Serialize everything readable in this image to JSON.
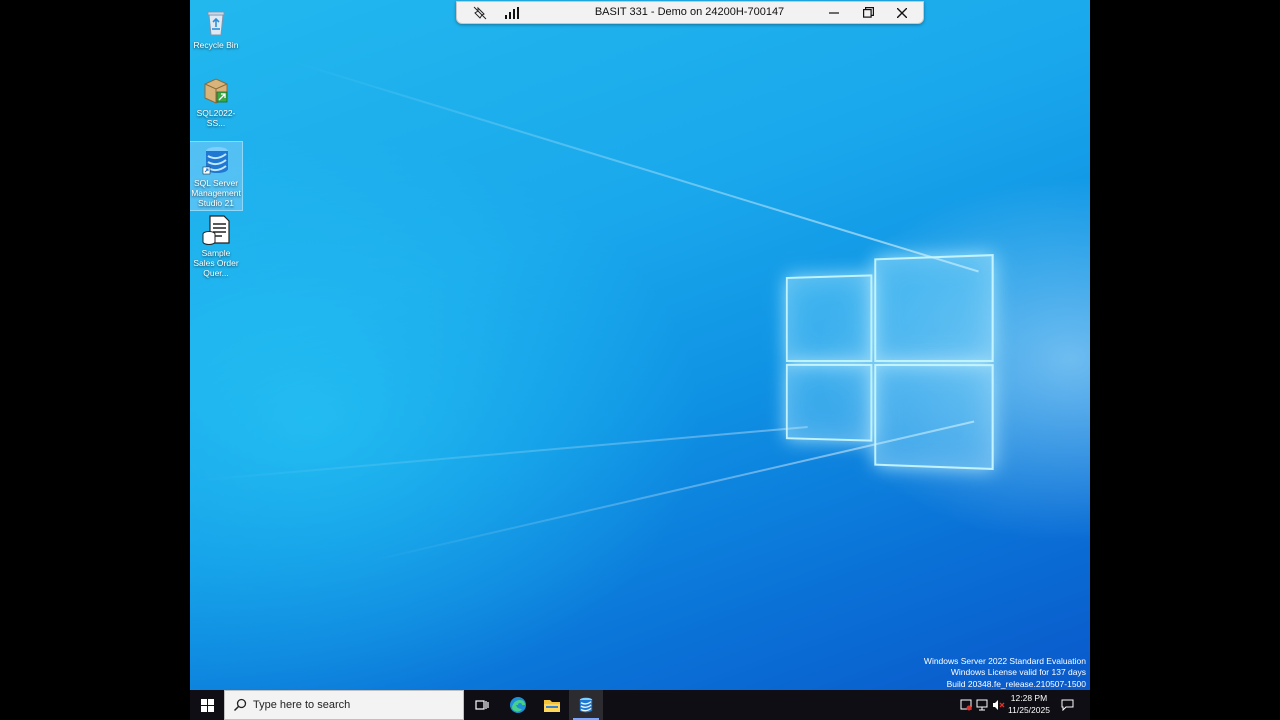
{
  "desktop": {
    "icons": [
      {
        "label": "Recycle Bin",
        "icon": "recycle-bin-icon"
      },
      {
        "label": "SQL2022-SS...",
        "icon": "installer-package-icon"
      },
      {
        "label": "SQL Server Management Studio 21",
        "icon": "ssms-icon"
      },
      {
        "label": "Sample Sales Order Quer...",
        "icon": "sql-script-file-icon"
      }
    ],
    "watermark": {
      "line1": "Windows Server 2022 Standard Evaluation",
      "line2": "Windows License valid for 137 days",
      "line3": "Build 20348.fe_release.210507-1500"
    }
  },
  "rdp_bar": {
    "title": "BASIT 331 - Demo on 24200H-700147",
    "pin_icon": "unpin-icon",
    "signal_icon": "connection-quality-icon"
  },
  "taskbar": {
    "search_placeholder": "Type here to search",
    "apps": [
      {
        "name": "Task View",
        "icon": "task-view-icon"
      },
      {
        "name": "Microsoft Edge",
        "icon": "edge-icon"
      },
      {
        "name": "File Explorer",
        "icon": "folder-icon"
      },
      {
        "name": "SQL Server Management Studio",
        "icon": "ssms-icon",
        "active": true
      }
    ],
    "tray_icons": [
      "defender-alert-icon",
      "network-icon",
      "volume-muted-icon"
    ],
    "time": "12:28 PM",
    "date": "11/25/2025"
  },
  "colors": {
    "wallpaper_top": "#22b8ee",
    "wallpaper_bottom": "#0a55c8",
    "taskbar": "#0e0e14"
  }
}
